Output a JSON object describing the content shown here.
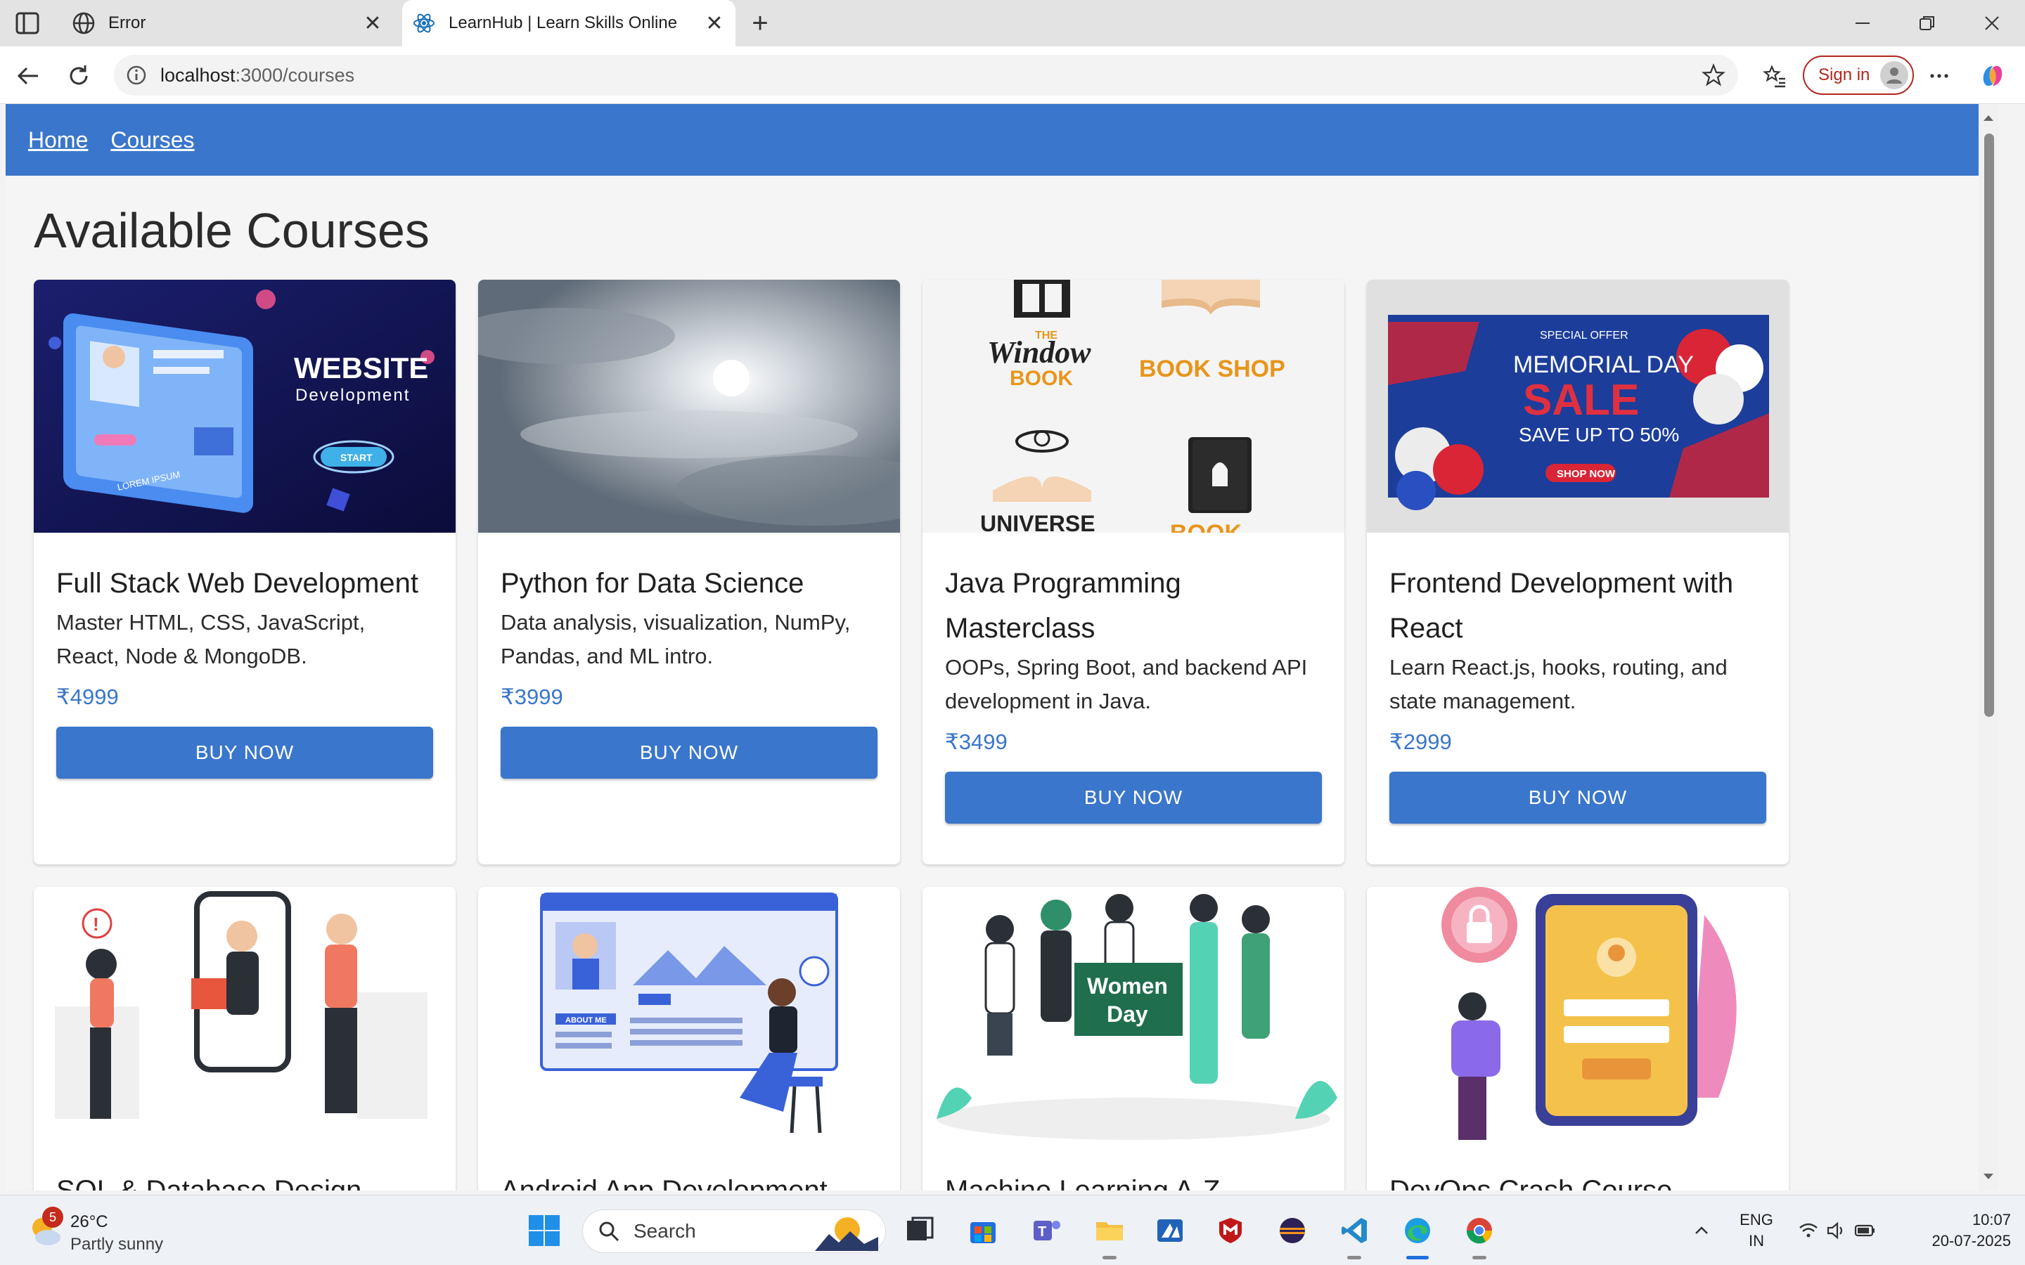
{
  "browser": {
    "tabs": [
      {
        "title": "Error",
        "active": false
      },
      {
        "title": "LearnHub | Learn Skills Online",
        "active": true
      }
    ],
    "new_tab_symbol": "+",
    "url_host": "localhost",
    "url_path": ":3000/courses",
    "sign_in_label": "Sign in"
  },
  "app": {
    "nav": [
      {
        "label": "Home"
      },
      {
        "label": "Courses"
      }
    ],
    "page_title": "Available Courses",
    "buy_label": "BUY NOW",
    "brand_color": "#3a76cb",
    "courses": [
      {
        "title": "Full Stack Web Development",
        "desc": "Master HTML, CSS, JavaScript, React, Node & MongoDB.",
        "price": "₹4999",
        "image": "website-development-illustration"
      },
      {
        "title": "Python for Data Science",
        "desc": "Data analysis, visualization, NumPy, Pandas, and ML intro.",
        "price": "₹3999",
        "image": "cloudy-sky-photo"
      },
      {
        "title": "Java Programming Masterclass",
        "desc": "OOPs, Spring Boot, and backend API development in Java.",
        "price": "₹3499",
        "image": "book-logos"
      },
      {
        "title": "Frontend Development with React",
        "desc": "Learn React.js, hooks, routing, and state management.",
        "price": "₹2999",
        "image": "memorial-day-sale-banner"
      },
      {
        "title": "SQL & Database Design",
        "image": "gift-smartphone-illustration"
      },
      {
        "title": "Android App Development",
        "image": "about-me-webpage-illustration"
      },
      {
        "title": "Machine Learning A-Z",
        "image": "women-day-illustration"
      },
      {
        "title": "DevOps Crash Course",
        "image": "mobile-login-illustration"
      }
    ],
    "banner_text": {
      "website": "WEBSITE",
      "development": "Development",
      "start": "START",
      "lorem": "LOREM IPSUM",
      "the_window_book": [
        "THE",
        "Window",
        "BOOK"
      ],
      "book_shop": "BOOK SHOP",
      "universe": "UNIVERSE",
      "book_partial": "BOOK",
      "special_offer": "SPECIAL OFFER",
      "memorial_day": "MEMORIAL DAY",
      "sale": "SALE",
      "save_up": "SAVE UP TO 50%",
      "shop_now": "SHOP NOW",
      "about_me": "ABOUT ME",
      "women_day": [
        "Women",
        "Day"
      ]
    }
  },
  "taskbar": {
    "weather_temp": "26°C",
    "weather_cond": "Partly sunny",
    "weather_badge": "5",
    "search_label": "Search",
    "lang_line1": "ENG",
    "lang_line2": "IN",
    "time": "10:07",
    "date": "20-07-2025"
  }
}
